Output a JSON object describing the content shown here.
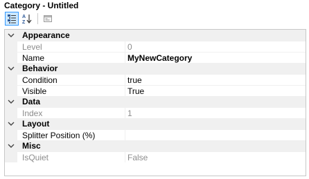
{
  "window": {
    "title": "Category - Untitled"
  },
  "toolbar": {
    "buttons": [
      {
        "icon": "categorized-icon",
        "active": true
      },
      {
        "icon": "alphabetical-sort-icon",
        "active": false
      },
      {
        "icon": "property-pages-icon",
        "active": false
      }
    ]
  },
  "grid": {
    "categories": [
      {
        "label": "Appearance",
        "properties": [
          {
            "name": "Level",
            "value": "0",
            "readonly": true,
            "bold": false
          },
          {
            "name": "Name",
            "value": "MyNewCategory",
            "readonly": false,
            "bold": true
          }
        ]
      },
      {
        "label": "Behavior",
        "properties": [
          {
            "name": "Condition",
            "value": "true",
            "readonly": false,
            "bold": false
          },
          {
            "name": "Visible",
            "value": "True",
            "readonly": false,
            "bold": false
          }
        ]
      },
      {
        "label": "Data",
        "properties": [
          {
            "name": "Index",
            "value": "1",
            "readonly": true,
            "bold": false
          }
        ]
      },
      {
        "label": "Layout",
        "properties": [
          {
            "name": "Splitter Position (%)",
            "value": "",
            "readonly": false,
            "bold": false
          }
        ]
      },
      {
        "label": "Misc",
        "properties": [
          {
            "name": "IsQuiet",
            "value": "False",
            "readonly": true,
            "bold": false
          }
        ]
      }
    ]
  }
}
